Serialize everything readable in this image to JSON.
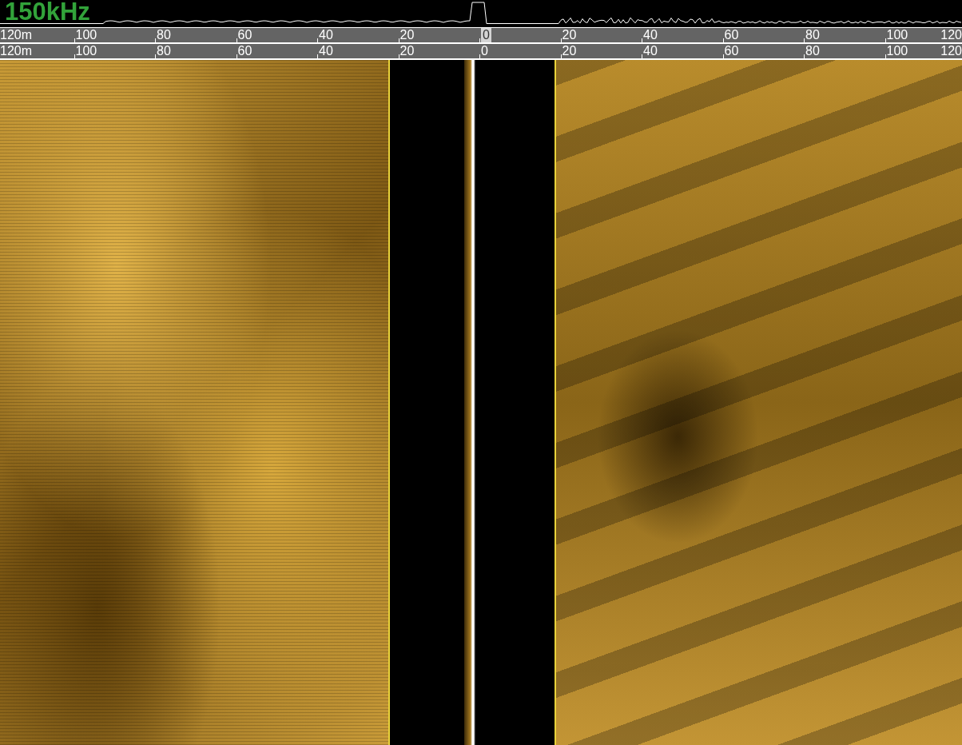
{
  "frequency": "150kHz",
  "scales": [
    {
      "ticks": [
        {
          "label": "120m",
          "selected": false
        },
        {
          "label": "100",
          "selected": false
        },
        {
          "label": "80",
          "selected": false
        },
        {
          "label": "60",
          "selected": false
        },
        {
          "label": "40",
          "selected": false
        },
        {
          "label": "20",
          "selected": false
        },
        {
          "label": "0",
          "selected": true
        },
        {
          "label": "20",
          "selected": false
        },
        {
          "label": "40",
          "selected": false
        },
        {
          "label": "60",
          "selected": false
        },
        {
          "label": "80",
          "selected": false
        },
        {
          "label": "100",
          "selected": false
        },
        {
          "label": "120",
          "selected": false
        }
      ]
    },
    {
      "ticks": [
        {
          "label": "120m",
          "selected": false
        },
        {
          "label": "100",
          "selected": false
        },
        {
          "label": "80",
          "selected": false
        },
        {
          "label": "60",
          "selected": false
        },
        {
          "label": "40",
          "selected": false
        },
        {
          "label": "20",
          "selected": false
        },
        {
          "label": "0",
          "selected": false
        },
        {
          "label": "20",
          "selected": false
        },
        {
          "label": "40",
          "selected": false
        },
        {
          "label": "60",
          "selected": false
        },
        {
          "label": "80",
          "selected": false
        },
        {
          "label": "100",
          "selected": false
        },
        {
          "label": "120",
          "selected": false
        }
      ]
    }
  ]
}
